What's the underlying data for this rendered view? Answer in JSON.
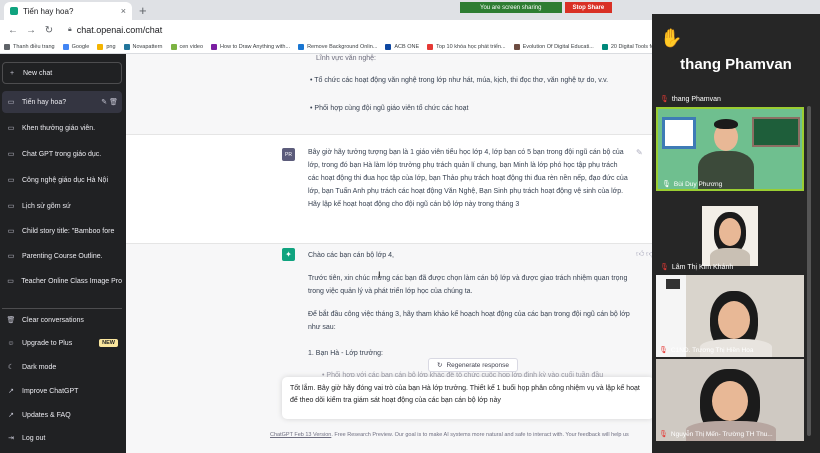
{
  "browser": {
    "tab_title": "Tiến hay hoa?",
    "tab_close": "×",
    "new_tab": "+",
    "url": "chat.openai.com/chat",
    "sharing_text": "You are screen sharing",
    "stop_share": "Stop Share",
    "bookmarks": [
      "Thanh điều trang",
      "Google",
      "png",
      "Novapattern",
      "cen video",
      "How to Draw Anything with...",
      "Remove Background Onlin...",
      "ACB ONE",
      "Top 10 khóa học phát triển...",
      "Evolution Of Digital Educati...",
      "20 Digital Tools for Classro..."
    ]
  },
  "sidebar": {
    "new_chat": "New chat",
    "chats": [
      "Tiến hay hoa?",
      "Khen thưởng giáo viên.",
      "Chat GPT trong giáo dục.",
      "Công nghệ giáo dục Hà Nội",
      "Lịch sử gõm sứ",
      "Child story title: \"Bamboo fore",
      "Parenting Course Outline.",
      "Teacher Online Class Image Pro"
    ],
    "bottom": [
      "Clear conversations",
      "Upgrade to Plus",
      "Dark mode",
      "Improve ChatGPT",
      "Updates & FAQ",
      "Log out"
    ],
    "new_badge": "NEW"
  },
  "chat": {
    "prev_lines": [
      "Lĩnh vực văn nghệ:",
      "Tổ chức các hoạt động văn nghệ trong lớp như hát, múa, kịch, thi đọc thơ, văn nghệ tự do, v.v.",
      "Phối hợp cùng đội ngũ giáo viên tổ chức các hoạt"
    ],
    "user_avatar": "PR",
    "user_message": "Bây giờ hãy tưởng tượng bạn là 1 giáo viên tiểu học lớp 4, lớp bạn có 5 bạn trong đội ngũ cán bộ của lớp, trong đó bạn Hà làm lớp trưởng phụ trách quản lí chung, bạn Minh là lớp phó học tập phụ trách các hoạt động thi đua học tập của lớp, bạn Thảo phụ trách hoạt động thi đua rèn nền nếp, đạo đức của lớp, bạn Tuấn Anh phụ trách các hoạt động Văn Nghệ, Bạn Sinh phụ trách hoạt động vệ sinh của lớp. Hãy lập kế hoạt hoạt động cho đội ngũ cán bộ lớp này trong tháng 3",
    "bot_greeting": "Chào các bạn cán bộ lớp 4,",
    "bot_para1": "Trước tiên, xin chúc mừng các bạn đã được chọn làm cán bộ lớp và được giao trách nhiệm quan trọng trong việc quản lý và phát triển lớp học của chúng ta.",
    "bot_para2": "Để bắt đầu công việc tháng 3, hãy tham khảo kế hoạch hoạt động của các bạn trong đội ngũ cán bộ lớp như sau:",
    "bot_list1": "Bạn Hà - Lớp trưởng:",
    "bot_list1_sub": "Phối hợp với các bạn cán bộ lớp khác để tổ chức cuộc họp lớp định kỳ vào cuối tuần đầu",
    "regen": "Regenerate response",
    "input_value": "Tốt lắm. Bây giờ hãy đóng vai trò của bạn Hà lớp trưởng. Thiết kế 1 buổi họp phân công nhiệm vụ và lập kế hoạt để theo dõi kiểm tra giám sát hoạt động của các bạn cán bộ lớp này",
    "footer_version": "ChatGPT Feb 13 Version",
    "footer_text": ". Free Research Preview. Our goal is to make AI systems more natural and safe to interact with. Your feedback will help us"
  },
  "meeting": {
    "host_name": "thang Phamvan",
    "host_label": "thang Phamvan",
    "participants": [
      "Bùi Duy Phương",
      "Lâm Thị Kim Khánh",
      "C1ND. Trương Thị Hiền Hoa",
      "Nguyễn Thị Mến- Trường TH Thu..."
    ]
  },
  "colors": {
    "sidebar_bg": "#202123",
    "accent": "#10a37f",
    "meeting_bg": "#262626",
    "speaking_border": "#9acd32"
  }
}
